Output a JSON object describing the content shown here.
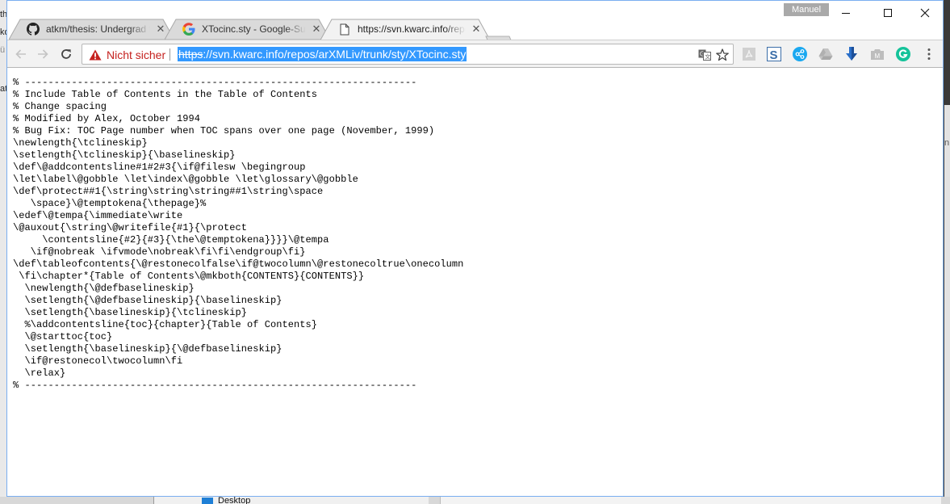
{
  "background": {
    "left_fragments": [
      "th",
      "ko",
      "ü",
      "at"
    ],
    "right_fragment": "n",
    "bottom_folder_label": "Desktop"
  },
  "window": {
    "profile_name": "Manuel",
    "controls": {
      "minimize": "minimize",
      "maximize": "maximize",
      "close": "close"
    }
  },
  "tabs": [
    {
      "title": "atkm/thesis: Undergrad thesis",
      "favicon": "github-icon",
      "active": false
    },
    {
      "title": "XTocinc.sty - Google-Suche",
      "favicon": "google-icon",
      "active": false
    },
    {
      "title": "https://svn.kwarc.info/repos/arXMLiv/trunk/sty/XTocinc.sty",
      "favicon": "page-icon",
      "active": true
    }
  ],
  "toolbar": {
    "security_label": "Nicht sicher",
    "url_scheme": "https",
    "url_rest": "://svn.kwarc.info/repos/arXMLiv/trunk/sty/XTocinc.sty",
    "extensions": [
      "pdf-icon",
      "s-icon",
      "share-icon",
      "drive-icon",
      "download-icon",
      "m-icon",
      "grammarly-icon",
      "menu-icon"
    ],
    "colors": {
      "warning": "#c5221f",
      "selection": "#3399ff",
      "grammarly": "#15c39a",
      "share": "#1aa8f0"
    }
  },
  "document": {
    "lines": [
      "% -------------------------------------------------------------------",
      "% Include Table of Contents in the Table of Contents",
      "% Change spacing",
      "% Modified by Alex, October 1994",
      "% Bug Fix: TOC Page number when TOC spans over one page (November, 1999)",
      "\\newlength{\\tclineskip}",
      "\\setlength{\\tclineskip}{\\baselineskip}",
      "\\def\\@addcontentsline#1#2#3{\\if@filesw \\begingroup",
      "\\let\\label\\@gobble \\let\\index\\@gobble \\let\\glossary\\@gobble",
      "\\def\\protect##1{\\string\\string\\string##1\\string\\space",
      "   \\space}\\@temptokena{\\thepage}%",
      "\\edef\\@tempa{\\immediate\\write",
      "\\@auxout{\\string\\@writefile{#1}{\\protect",
      "     \\contentsline{#2}{#3}{\\the\\@temptokena}}}}\\@tempa",
      "   \\if@nobreak \\ifvmode\\nobreak\\fi\\fi\\endgroup\\fi}",
      "\\def\\tableofcontents{\\@restonecolfalse\\if@twocolumn\\@restonecoltrue\\onecolumn",
      " \\fi\\chapter*{Table of Contents\\@mkboth{CONTENTS}{CONTENTS}}",
      "  \\newlength{\\@defbaselineskip}",
      "  \\setlength{\\@defbaselineskip}{\\baselineskip}",
      "  \\setlength{\\baselineskip}{\\tclineskip}",
      "  %\\addcontentsline{toc}{chapter}{Table of Contents}",
      "  \\@starttoc{toc}",
      "  \\setlength{\\baselineskip}{\\@defbaselineskip}",
      "  \\if@restonecol\\twocolumn\\fi",
      "  \\relax}",
      "% -------------------------------------------------------------------"
    ]
  }
}
